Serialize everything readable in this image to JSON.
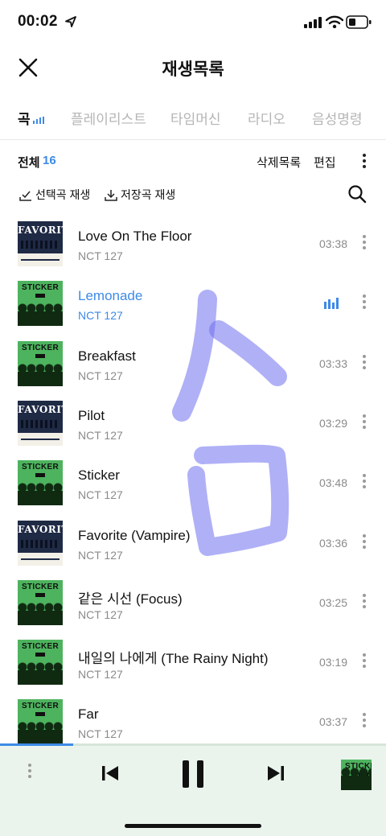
{
  "status_bar": {
    "time": "00:02"
  },
  "header": {
    "title": "재생목록",
    "close_icon": "close-icon"
  },
  "tabs": [
    {
      "label": "곡",
      "active": true
    },
    {
      "label": "플레이리스트",
      "active": false
    },
    {
      "label": "타임머신",
      "active": false
    },
    {
      "label": "라디오",
      "active": false
    },
    {
      "label": "음성명령",
      "active": false
    }
  ],
  "list_header": {
    "total_label": "전체",
    "total_count": "16",
    "delete_history": "삭제목록",
    "edit": "편집"
  },
  "play_options": {
    "play_selected": "선택곡 재생",
    "play_saved": "저장곡 재생"
  },
  "songs": [
    {
      "title": "Love On The Floor",
      "artist": "NCT 127",
      "duration": "03:38",
      "album": "favorite"
    },
    {
      "title": "Lemonade",
      "artist": "NCT 127",
      "duration": "",
      "album": "sticker",
      "playing": true
    },
    {
      "title": "Breakfast",
      "artist": "NCT 127",
      "duration": "03:33",
      "album": "sticker"
    },
    {
      "title": "Pilot",
      "artist": "NCT 127",
      "duration": "03:29",
      "album": "favorite"
    },
    {
      "title": "Sticker",
      "artist": "NCT 127",
      "duration": "03:48",
      "album": "sticker"
    },
    {
      "title": "Favorite (Vampire)",
      "artist": "NCT 127",
      "duration": "03:36",
      "album": "favorite"
    },
    {
      "title": "같은 시선 (Focus)",
      "artist": "NCT 127",
      "duration": "03:25",
      "album": "sticker"
    },
    {
      "title": "내일의 나에게 (The Rainy Night)",
      "artist": "NCT 127",
      "duration": "03:19",
      "album": "sticker"
    },
    {
      "title": "Far",
      "artist": "NCT 127",
      "duration": "03:37",
      "album": "sticker"
    }
  ],
  "album_art": {
    "favorite": {
      "title": "FAVORITE",
      "group": "NCT127"
    },
    "sticker": {
      "title": "STICKER"
    }
  },
  "player": {
    "progress": 0.19,
    "state": "playing"
  },
  "colors": {
    "accent": "#3d8ae6",
    "player_bg": "#eaf4ec",
    "pen_stroke": "#6f6ff0"
  }
}
